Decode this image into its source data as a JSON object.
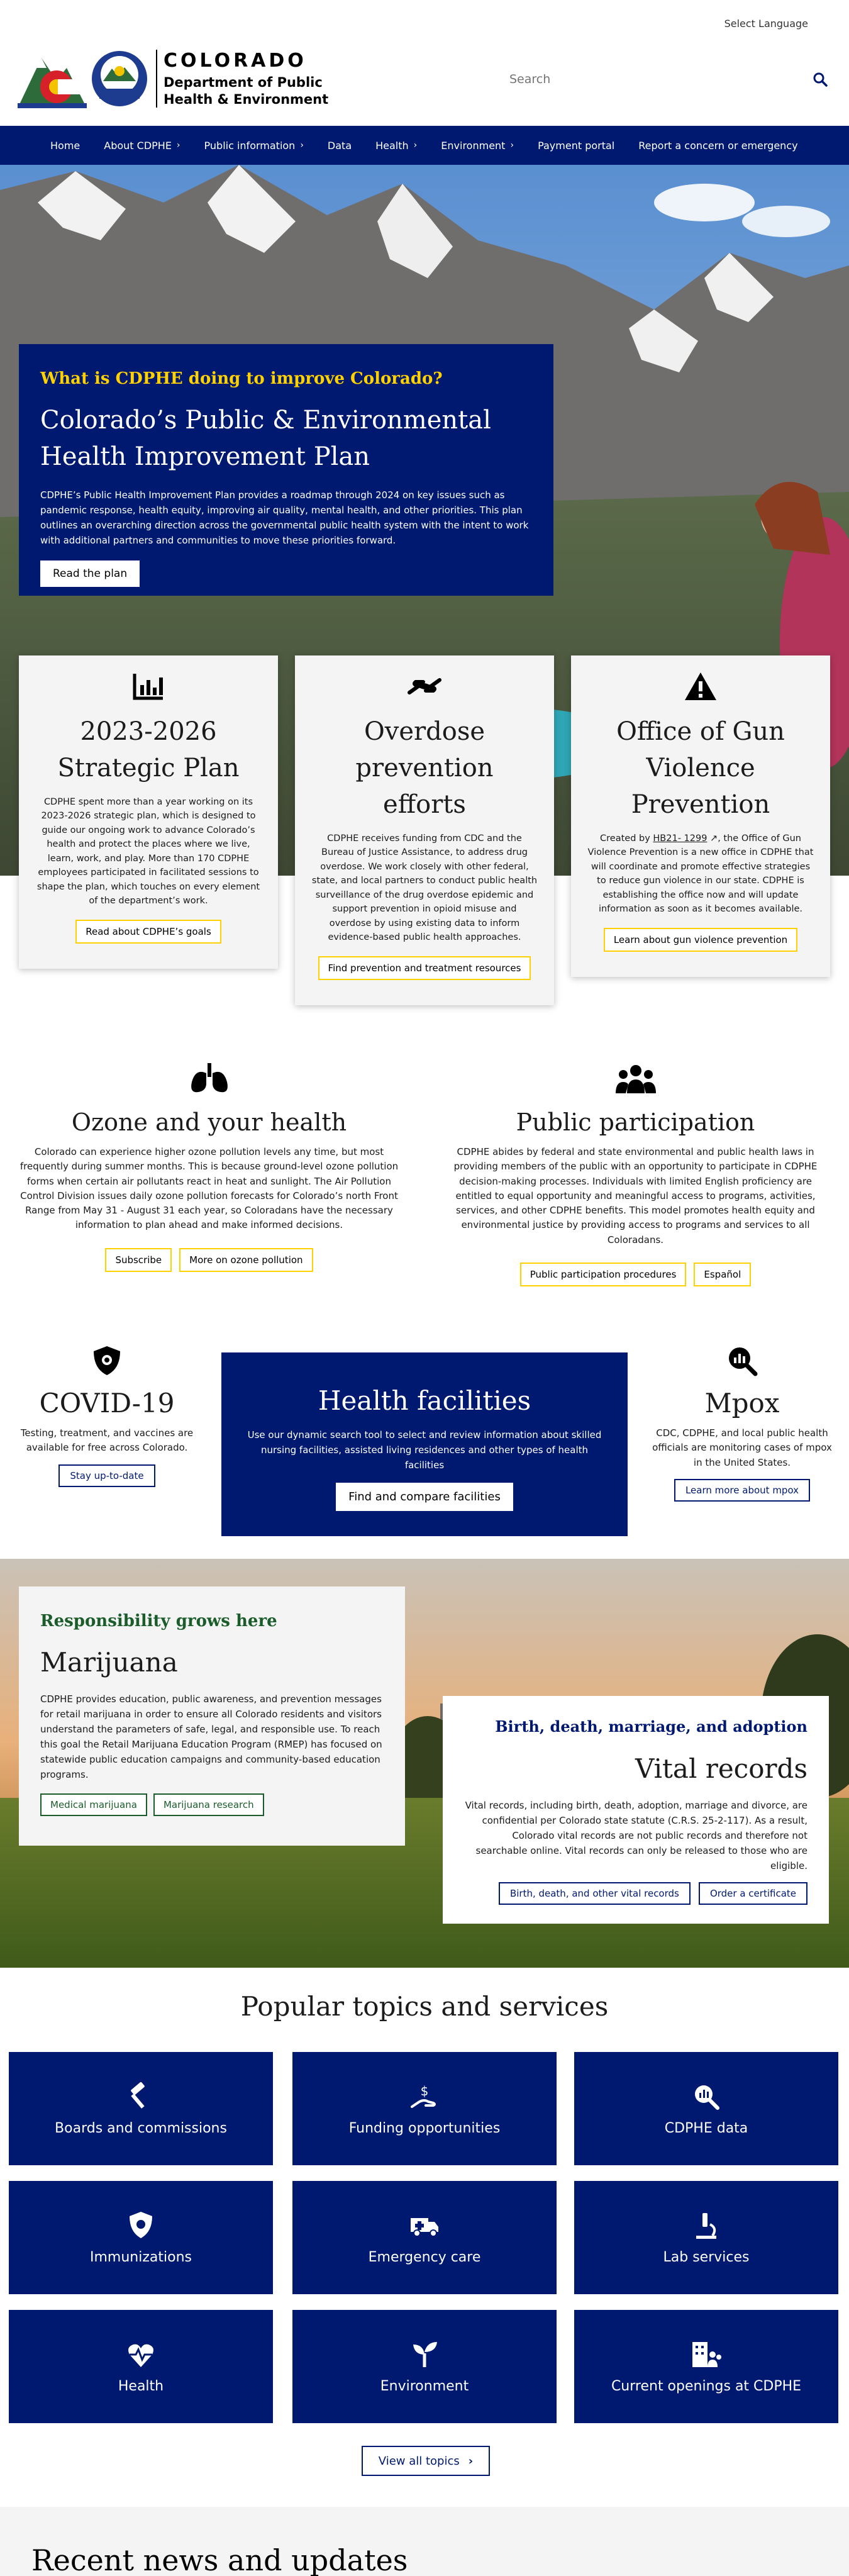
{
  "header": {
    "language": "Select Language",
    "brand_state": "COLORADO",
    "brand_dept_line1": "Department of Public",
    "brand_dept_line2": "Health & Environment",
    "dept_badge": "CDPHE",
    "search_placeholder": "Search"
  },
  "nav": {
    "items": [
      {
        "label": "Home",
        "has_menu": false
      },
      {
        "label": "About CDPHE",
        "has_menu": true
      },
      {
        "label": "Public information",
        "has_menu": true
      },
      {
        "label": "Data",
        "has_menu": false
      },
      {
        "label": "Health",
        "has_menu": true
      },
      {
        "label": "Environment",
        "has_menu": true
      },
      {
        "label": "Payment portal",
        "has_menu": false
      },
      {
        "label": "Report a concern or emergency",
        "has_menu": false
      }
    ]
  },
  "hero": {
    "eyebrow": "What is CDPHE doing to improve Colorado?",
    "title": "Colorado’s Public & Environmental Health Improvement Plan",
    "description": "CDPHE’s Public Health Improvement Plan provides a roadmap through 2024 on key issues such as pandemic response, health equity, improving air quality, mental health, and other priorities. This plan outlines an overarching direction across the governmental public health system with the intent to work with additional partners and communities to move these priorities forward.",
    "button": "Read the plan"
  },
  "cards": [
    {
      "icon": "chart-icon",
      "title": "2023-2026 Strategic Plan",
      "description": "CDPHE spent more than a year working on its 2023-2026 strategic plan, which is designed to guide our ongoing work to advance Colorado’s health and protect the places where we live, learn, work, and play. More than 170 CDPHE employees participated in facilitated sessions to shape the plan, which touches on every element of the department’s work.",
      "button": "Read about CDPHE’s goals"
    },
    {
      "icon": "hand-holding-icon",
      "title": "Overdose prevention efforts",
      "description": "CDPHE receives funding from CDC and the Bureau of Justice Assistance, to address drug overdose. We work closely with other federal, state, and local partners to conduct public health surveillance of the drug overdose epidemic and support prevention in opioid misuse and overdose by using existing data to inform evidence-based public health approaches.",
      "button": "Find prevention and treatment resources"
    },
    {
      "icon": "warning-icon",
      "title": "Office of Gun Violence Prevention",
      "description_pre": "Created by ",
      "description_link": "HB21- 1299",
      "description_post": ", the Office of Gun Violence Prevention is a new office in CDPHE that will coordinate and promote effective strategies to reduce gun violence in our state. CDPHE is establishing the office now and will update information as soon as it becomes available.",
      "button": "Learn about gun violence prevention"
    }
  ],
  "ozone": {
    "title": "Ozone and your health",
    "description": "Colorado can experience higher ozone pollution levels any time, but most frequently during summer months. This is because ground-level ozone pollution forms when certain air pollutants react in heat and sunlight. The Air Pollution Control Division issues daily ozone pollution forecasts for Colorado’s north Front Range from May 31 - August 31 each year, so Coloradans have the necessary information to plan ahead and make informed decisions.",
    "buttons": [
      "Subscribe",
      "More on ozone pollution"
    ]
  },
  "participation": {
    "title": "Public participation",
    "description": "CDPHE abides by federal and state environmental and public health laws in providing members of the public with an opportunity to participate in CDPHE decision-making processes. Individuals with limited English proficiency are entitled to equal opportunity and meaningful access to programs, activities, services, and other CDPHE benefits. This model promotes health equity and environmental justice by providing access to programs and services to all Coloradans.",
    "buttons": [
      "Public participation procedures",
      "Español"
    ]
  },
  "covid": {
    "title": "COVID-19",
    "description": "Testing, treatment, and vaccines are available for free across Colorado.",
    "button": "Stay up-to-date"
  },
  "health_facilities": {
    "title": "Health facilities",
    "description": "Use our dynamic search tool to select and review information about skilled nursing facilities, assisted living residences and other types of health facilities",
    "button": "Find and compare facilities"
  },
  "mpox": {
    "title": "Mpox",
    "description": "CDC, CDPHE, and local public health officials are monitoring cases of mpox in the United States.",
    "button": "Learn more about mpox"
  },
  "marijuana": {
    "eyebrow": "Responsibility grows here",
    "title": "Marijuana",
    "description": "CDPHE provides education, public awareness, and prevention messages for retail marijuana in order to ensure all Colorado residents and visitors understand the parameters of safe, legal, and responsible use. To reach this goal the Retail Marijuana Education Program (RMEP) has focused on statewide public education campaigns and community-based education programs.",
    "buttons": [
      "Medical marijuana",
      "Marijuana research"
    ]
  },
  "vital": {
    "eyebrow": "Birth, death, marriage, and adoption",
    "title": "Vital records",
    "description": "Vital records, including birth, death, adoption, marriage and divorce, are confidential per Colorado state statute (C.R.S. 25-2-117). As a result, Colorado vital records are not public records and therefore not searchable online. Vital records can only be released to those who are eligible.",
    "buttons": [
      "Birth, death, and other vital records",
      "Order a certificate"
    ]
  },
  "popular": {
    "title": "Popular topics and services",
    "tiles": [
      {
        "label": "Boards and commissions",
        "icon": "gavel-icon"
      },
      {
        "label": "Funding opportunities",
        "icon": "hand-dollar-icon"
      },
      {
        "label": "CDPHE data",
        "icon": "chart-search-icon"
      },
      {
        "label": "Immunizations",
        "icon": "shield-virus-icon"
      },
      {
        "label": "Emergency care",
        "icon": "ambulance-icon"
      },
      {
        "label": "Lab services",
        "icon": "microscope-icon"
      },
      {
        "label": "Health",
        "icon": "heart-pulse-icon"
      },
      {
        "label": "Environment",
        "icon": "seedling-icon"
      },
      {
        "label": "Current openings at CDPHE",
        "icon": "building-people-icon"
      }
    ],
    "view_all": "View all topics"
  },
  "news": {
    "title": "Recent news and updates"
  },
  "colors": {
    "navy": "#001970",
    "gold": "#ffd100",
    "green": "#1a5c2a"
  }
}
